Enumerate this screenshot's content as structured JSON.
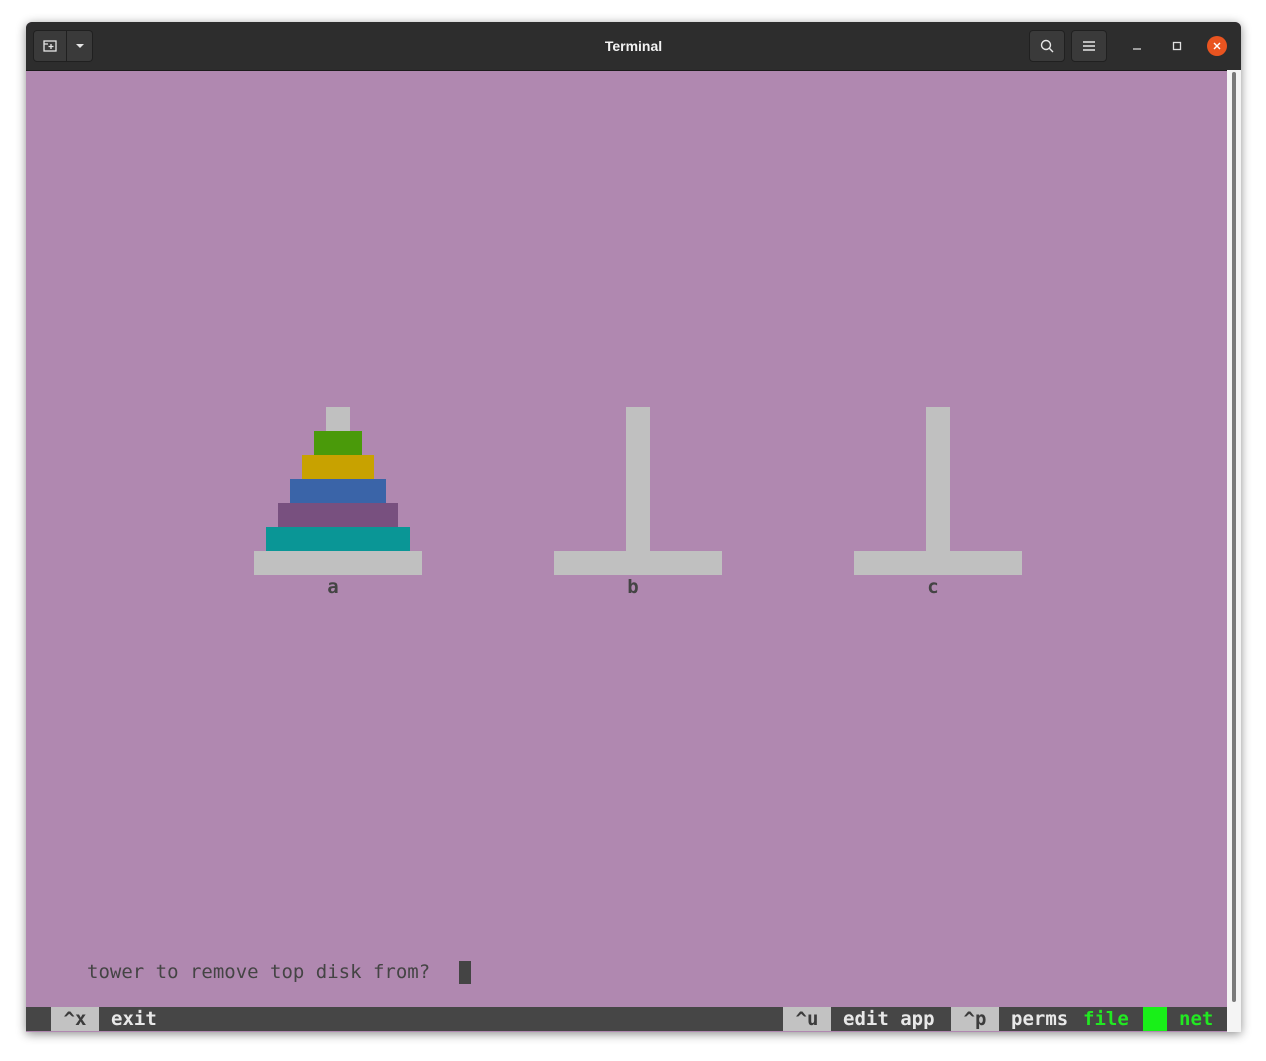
{
  "window": {
    "title": "Terminal"
  },
  "titlebar": {
    "icons": [
      "new-tab-icon",
      "chevron-down-icon",
      "search-icon",
      "hamburger-menu-icon",
      "minimize-icon",
      "maximize-icon",
      "close-icon"
    ],
    "close_color": "#e95420"
  },
  "game": {
    "background_color": "#b088b0",
    "rod_color": "#c0c0c0",
    "towers": [
      {
        "label": "a",
        "disks_bottom_to_top": [
          {
            "size": 5,
            "color": "#0a9696"
          },
          {
            "size": 4,
            "color": "#78507f"
          },
          {
            "size": 3,
            "color": "#3a64a8"
          },
          {
            "size": 2,
            "color": "#c8a200"
          },
          {
            "size": 1,
            "color": "#4a9a0a"
          }
        ]
      },
      {
        "label": "b",
        "disks_bottom_to_top": []
      },
      {
        "label": "c",
        "disks_bottom_to_top": []
      }
    ],
    "prompt": "tower to remove top disk from? "
  },
  "statusbar": {
    "items": [
      {
        "key": "^x",
        "label": "exit"
      },
      {
        "key": "^u",
        "label": "edit app"
      },
      {
        "key": "^p",
        "label": "perms"
      }
    ],
    "indicators": [
      {
        "label": "file",
        "color": "#22e822"
      },
      {
        "label": "net",
        "color": "#22e822"
      }
    ]
  }
}
